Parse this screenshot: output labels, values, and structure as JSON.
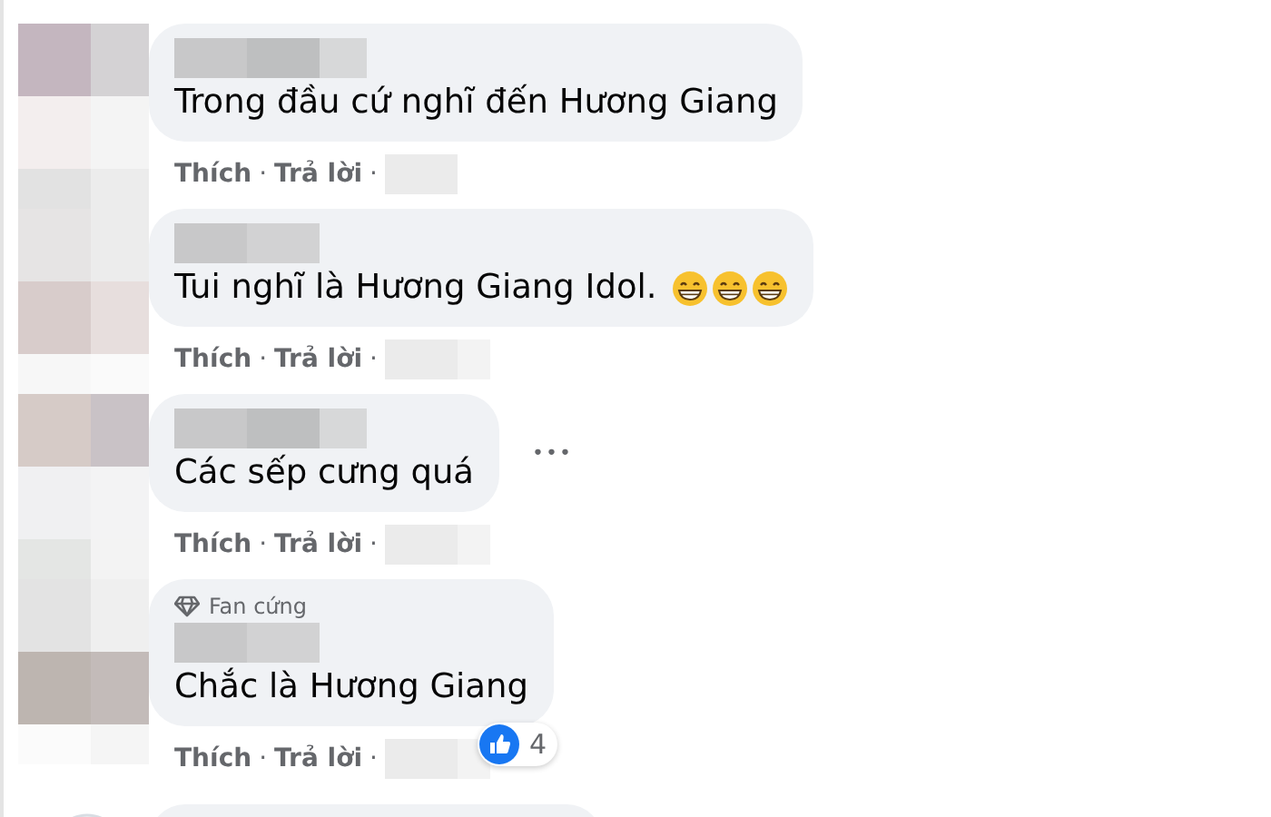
{
  "comments": [
    {
      "text": "Trong đầu cứ nghĩ đến Hương Giang",
      "more_button": false,
      "actions": [
        "Thích",
        "Trả lời"
      ]
    },
    {
      "text": "Tui nghĩ là Hương Giang Idol.",
      "emojis": [
        {
          "kind": "grin"
        },
        {
          "kind": "grin"
        },
        {
          "kind": "grin"
        }
      ],
      "more_button": false,
      "actions": [
        "Thích",
        "Trả lời"
      ]
    },
    {
      "text": "Các sếp cưng quá",
      "more_button": true,
      "actions": [
        "Thích",
        "Trả lời"
      ]
    },
    {
      "badge": "Fan cứng",
      "text": "Chắc là Hương Giang",
      "more_button": false,
      "reaction_count": "4",
      "actions": [
        "Thích",
        "Trả lời"
      ]
    }
  ],
  "separator": "·",
  "more_button_label": "•••"
}
